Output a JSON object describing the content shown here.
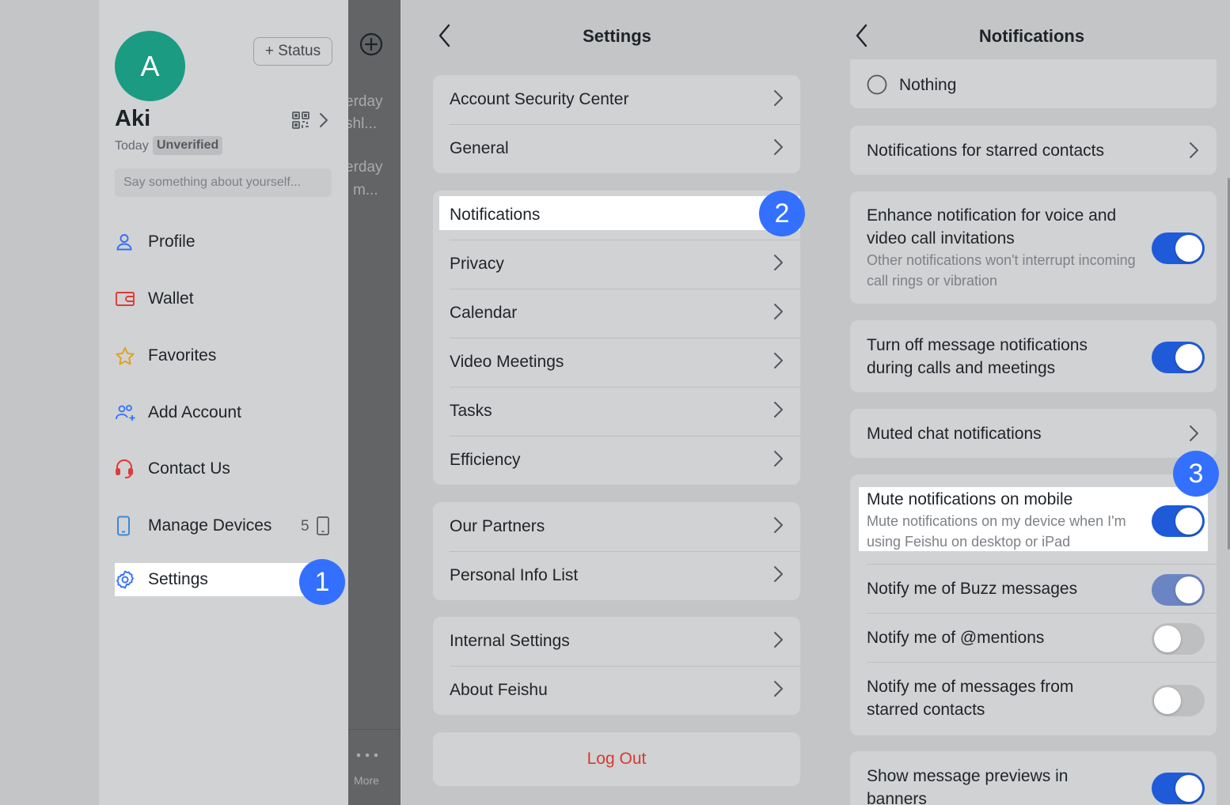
{
  "panel1": {
    "avatar_initial": "A",
    "status_button": "+ Status",
    "username": "Aki",
    "date": "Today",
    "verification": "Unverified",
    "bio_placeholder": "Say something about yourself...",
    "menu": [
      {
        "label": "Profile",
        "icon": "person-icon"
      },
      {
        "label": "Wallet",
        "icon": "wallet-icon"
      },
      {
        "label": "Favorites",
        "icon": "star-icon"
      },
      {
        "label": "Add Account",
        "icon": "add-account-icon"
      },
      {
        "label": "Contact Us",
        "icon": "headset-icon"
      },
      {
        "label": "Manage Devices",
        "icon": "phone-icon",
        "count": "5"
      },
      {
        "label": "Settings",
        "icon": "gear-icon"
      }
    ],
    "step_badge": "1",
    "background_chat": {
      "line1": "erday",
      "line2": "shl...",
      "line3": "erday",
      "line4": "m...",
      "more_label": "More"
    }
  },
  "panel2": {
    "title": "Settings",
    "groups": [
      [
        "Account Security Center",
        "General"
      ],
      [
        "Notifications",
        "Privacy",
        "Calendar",
        "Video Meetings",
        "Tasks",
        "Efficiency"
      ],
      [
        "Our Partners",
        "Personal Info List"
      ],
      [
        "Internal Settings",
        "About Feishu"
      ]
    ],
    "logout": "Log Out",
    "step_badge": "2"
  },
  "panel3": {
    "title": "Notifications",
    "nothing_option": "Nothing",
    "starred_contacts": "Notifications for starred contacts",
    "enhance_title": "Enhance notification for voice and video call invitations",
    "enhance_sub": "Other notifications won't interrupt incoming call rings or vibration",
    "turn_off_title": "Turn off message notifications during calls and meetings",
    "muted_chat": "Muted chat notifications",
    "mute_mobile_title": "Mute notifications on mobile",
    "mute_mobile_sub": "Mute notifications on my device when I'm using Feishu on desktop or iPad",
    "buzz": "Notify me of Buzz messages",
    "mentions": "Notify me of @mentions",
    "starred_messages": "Notify me of messages from starred contacts",
    "previews": "Show message previews in banners",
    "step_badge": "3"
  },
  "colors": {
    "accent": "#3370ff",
    "toggle_on": "#1f5bd9",
    "toggle_dim": "#6b85c4",
    "toggle_off": "#bebfc1",
    "logout_red": "#d83931"
  }
}
